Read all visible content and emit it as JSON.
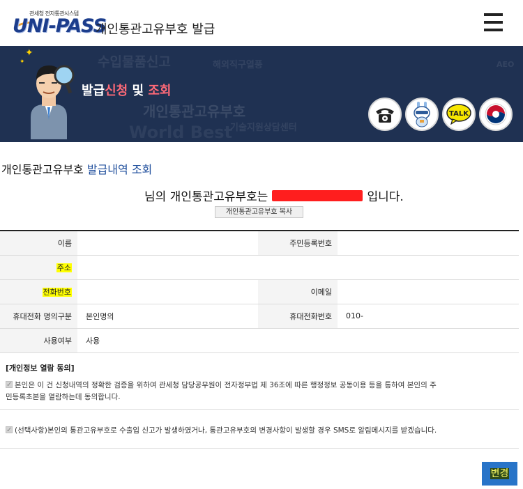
{
  "header": {
    "logo_subtitle": "관세청 전자통관시스템",
    "logo_text": "UNI-PASS",
    "title": "개인통관고유부호  발급"
  },
  "banner": {
    "title_part1": "발급",
    "title_part2": "신청",
    "title_part3": " 및 ",
    "title_part4": "조회",
    "background_words": [
      "수입물품신고",
      "해외직구열풍",
      "개인통관고유부호",
      "기술지원상담센터",
      "World Best",
      "AEO"
    ]
  },
  "quick_icons": [
    {
      "name": "phone-icon"
    },
    {
      "name": "chatbot-icon"
    },
    {
      "name": "talk-icon",
      "label": "TALK"
    },
    {
      "name": "government-emblem-icon"
    }
  ],
  "section": {
    "title_part1": "개인통관고유부호 ",
    "title_part2": "발급내역 조회"
  },
  "result": {
    "prefix": "님의 개인통관고유부호는",
    "suffix": "입니다.",
    "copy_button": "개인통관고유부호 복사"
  },
  "info_table": {
    "name_label": "이름",
    "rrn_label": "주민등록번호",
    "address_label": "주소",
    "phone_label": "전화번호",
    "email_label": "이메일",
    "mobile_type_label": "휴대전화 명의구분",
    "mobile_type_value": "본인명의",
    "mobile_label": "휴대전화번호",
    "mobile_value": "010-",
    "usage_label": "사용여부",
    "usage_value": "사용"
  },
  "consent": {
    "title": "[개인정보 열람 동의]",
    "item1_line1": "본인은 이 건 신청내역의 정확한 검증을 위하여 관세청 담당공무원이 전자정부법 제 36조에 따른 행정정보 공동이용 등을 통하여 본인의 주",
    "item1_line2": "민등록초본을 열람하는데 동의합니다.",
    "item2": "(선택사항)본인의 통관고유부호로 수출입 신고가 발생하였거나, 통관고유부호의 변경사항이 발생할 경우 SMS로 알림메시지를 받겠습니다."
  },
  "actions": {
    "change_button": "변경"
  }
}
